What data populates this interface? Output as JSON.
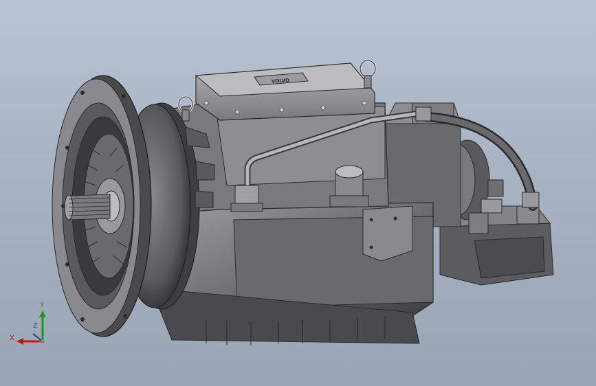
{
  "window": {
    "background_top": "#b8c4d4",
    "background_bottom": "#9aa6b6"
  },
  "model": {
    "logo_text": "VOLVO",
    "body_color": "#6f6f72",
    "highlight_color": "#a9a9ad",
    "shadow_color": "#2e2e30"
  },
  "triad": {
    "x_label": "X",
    "y_label": "Y",
    "z_label": "Z",
    "x_color": "#c01818",
    "y_color": "#1a9a1a",
    "z_color": "#1a3ab0"
  }
}
